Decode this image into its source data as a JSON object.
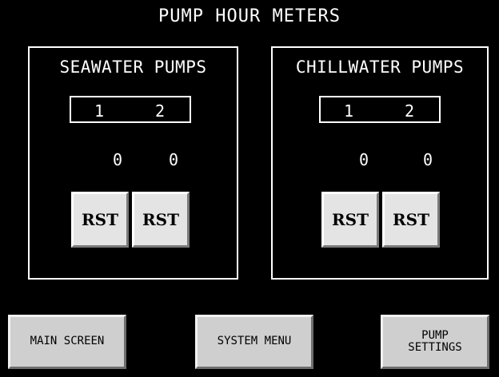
{
  "title": "PUMP HOUR METERS",
  "seawater": {
    "title": "SEAWATER PUMPS",
    "pump_labels": [
      "1",
      "2"
    ],
    "hours": [
      "0",
      "0"
    ],
    "reset_labels": [
      "RST",
      "RST"
    ]
  },
  "chillwater": {
    "title": "CHILLWATER PUMPS",
    "pump_labels": [
      "1",
      "2"
    ],
    "hours": [
      "0",
      "0"
    ],
    "reset_labels": [
      "RST",
      "RST"
    ]
  },
  "nav": {
    "main_screen": "MAIN SCREEN",
    "system_menu": "SYSTEM MENU",
    "pump_settings_line1": "PUMP",
    "pump_settings_line2": "SETTINGS"
  }
}
